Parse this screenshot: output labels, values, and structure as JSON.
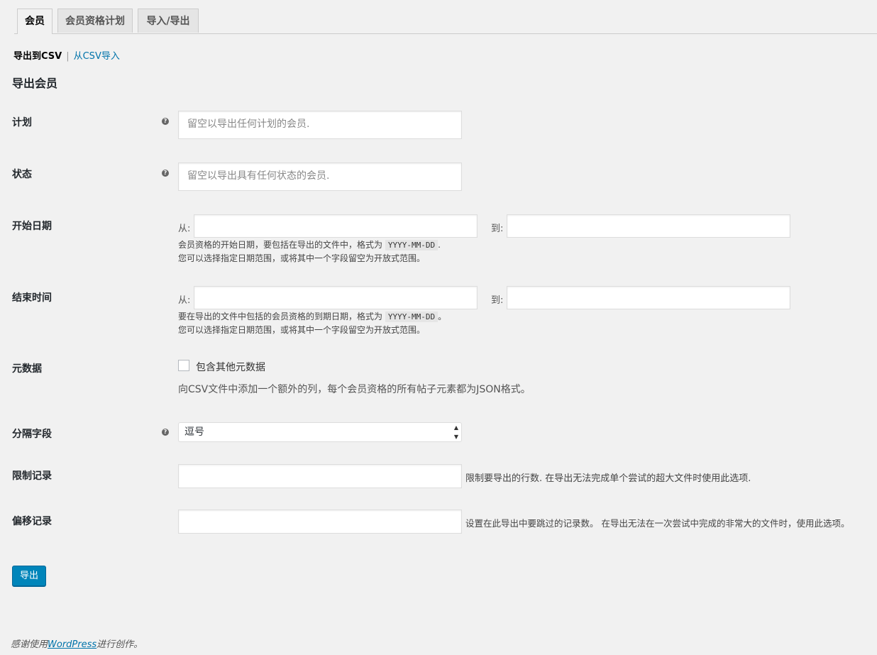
{
  "tabs": [
    "会员",
    "会员资格计划",
    "导入/导出"
  ],
  "subnav": {
    "current": "导出到CSV",
    "separator": "|",
    "link": "从CSV导入"
  },
  "section_title": "导出会员",
  "plan": {
    "label": "计划",
    "placeholder": "留空以导出任何计划的会员."
  },
  "status": {
    "label": "状态",
    "placeholder": "留空以导出具有任何状态的会员."
  },
  "start_date": {
    "label": "开始日期",
    "from": "从:",
    "to": "到:",
    "desc1_pre": "会员资格的开始日期，要包括在导出的文件中，格式为",
    "code": "YYYY-MM-DD",
    "desc1_post": ".",
    "desc2": "您可以选择指定日期范围，或将其中一个字段留空为开放式范围。"
  },
  "end_date": {
    "label": "结束时间",
    "from": "从:",
    "to": "到:",
    "desc1_pre": "要在导出的文件中包括的会员资格的到期日期，格式为",
    "code": "YYYY-MM-DD",
    "desc1_post": "。",
    "desc2": "您可以选择指定日期范围，或将其中一个字段留空为开放式范围。"
  },
  "meta": {
    "label": "元数据",
    "checkbox_label": "包含其他元数据",
    "desc": "向CSV文件中添加一个额外的列，每个会员资格的所有帖子元素都为JSON格式。"
  },
  "separator_field": {
    "label": "分隔字段",
    "value": "逗号"
  },
  "limit": {
    "label": "限制记录",
    "desc": "限制要导出的行数. 在导出无法完成单个尝试的超大文件时使用此选项."
  },
  "offset": {
    "label": "偏移记录",
    "desc": "设置在此导出中要跳过的记录数。 在导出无法在一次尝试中完成的非常大的文件时，使用此选项。"
  },
  "export_button": "导出",
  "footer": {
    "pre": "感谢使用",
    "link": "WordPress",
    "post": "进行创作。"
  }
}
